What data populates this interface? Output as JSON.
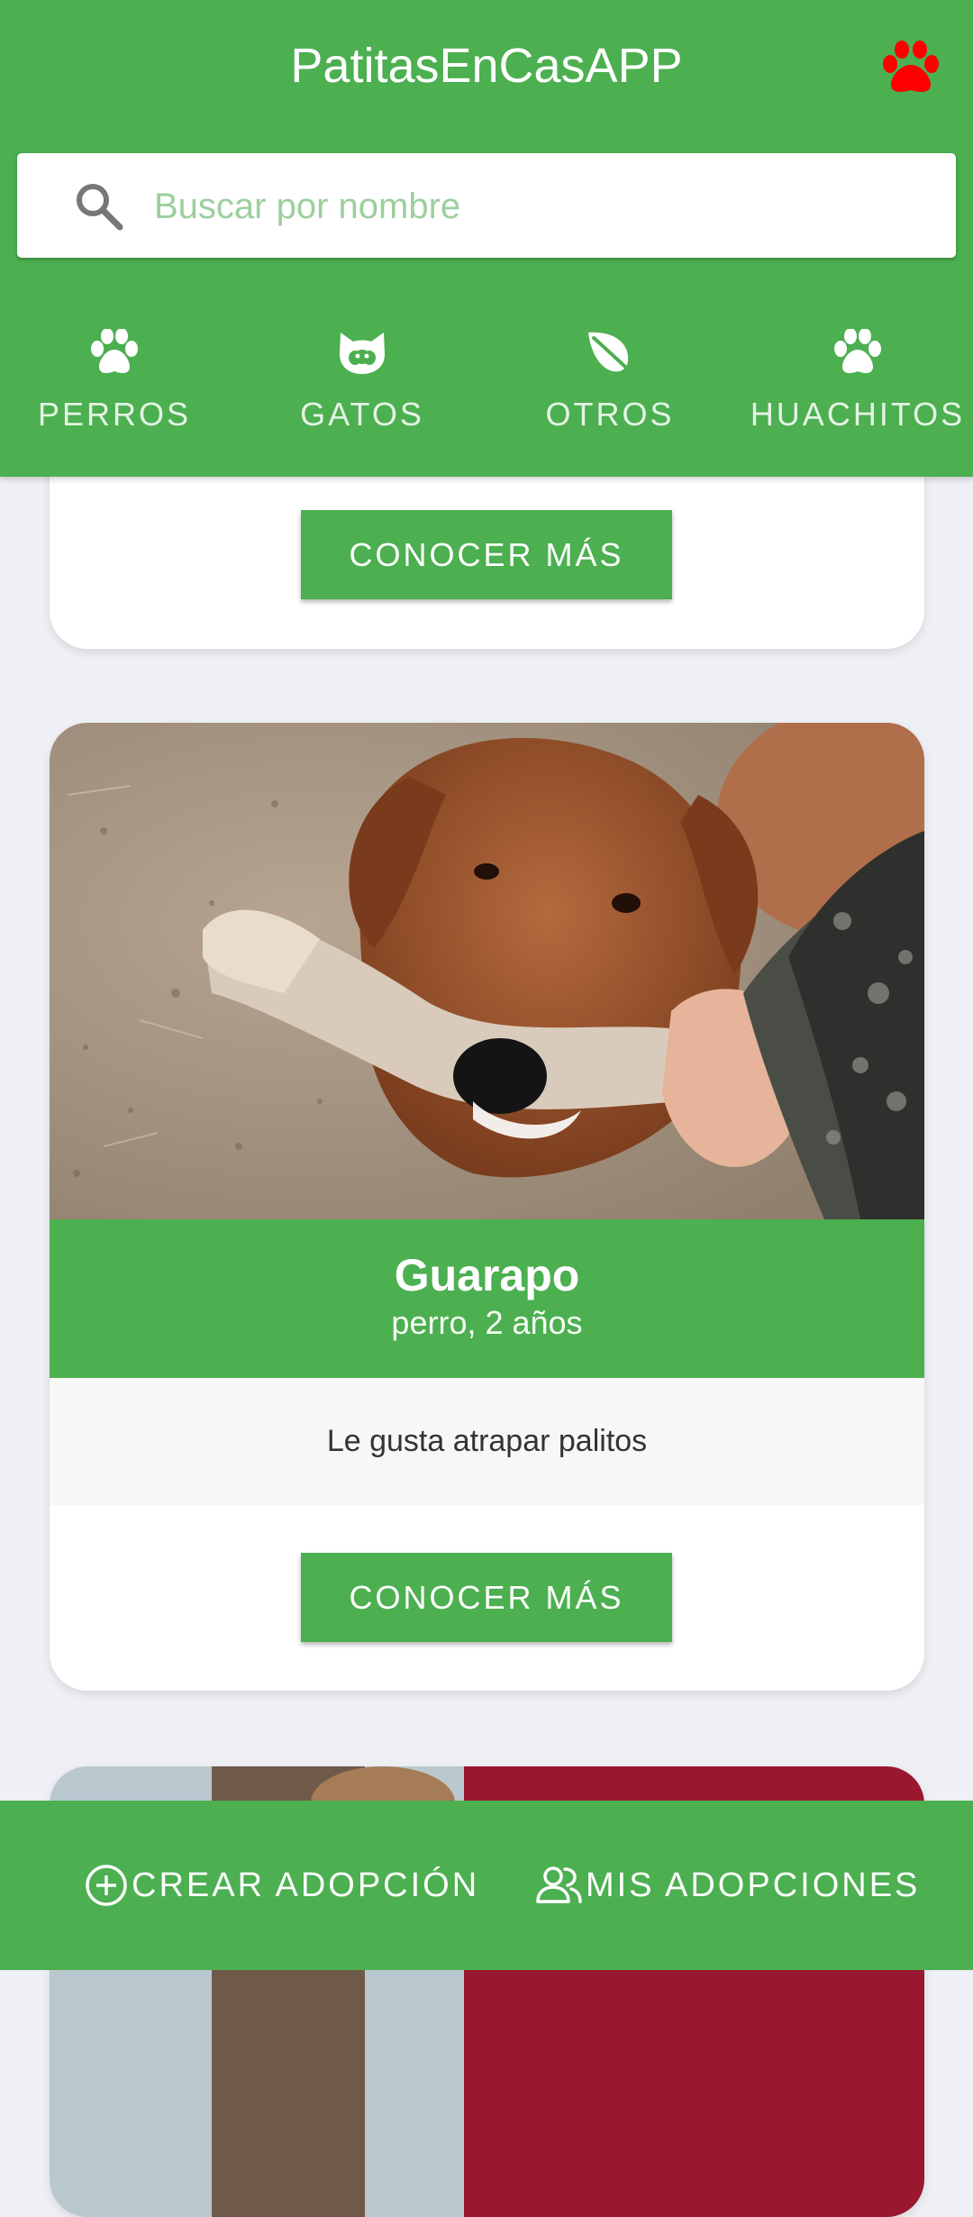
{
  "app": {
    "title": "PatitasEnCasAPP",
    "logo_icon": "paw-icon",
    "logo_color": "#ff0000"
  },
  "search": {
    "placeholder": "Buscar por nombre",
    "value": ""
  },
  "categories": [
    {
      "label": "PERROS",
      "icon": "paw-icon"
    },
    {
      "label": "GATOS",
      "icon": "cat-icon"
    },
    {
      "label": "OTROS",
      "icon": "leaf-icon"
    },
    {
      "label": "HUACHITOS",
      "icon": "paw-icon"
    }
  ],
  "cards": [
    {
      "button_label": "CONOCER MÁS"
    },
    {
      "name": "Guarapo",
      "meta": "perro, 2 años",
      "description": "Le gusta atrapar palitos",
      "button_label": "CONOCER MÁS"
    }
  ],
  "bottom_nav": {
    "create_label": "CREAR ADOPCIÓN",
    "mine_label": "MIS ADOPCIONES"
  },
  "colors": {
    "primary": "#4caf50",
    "background": "#eef0f5"
  }
}
